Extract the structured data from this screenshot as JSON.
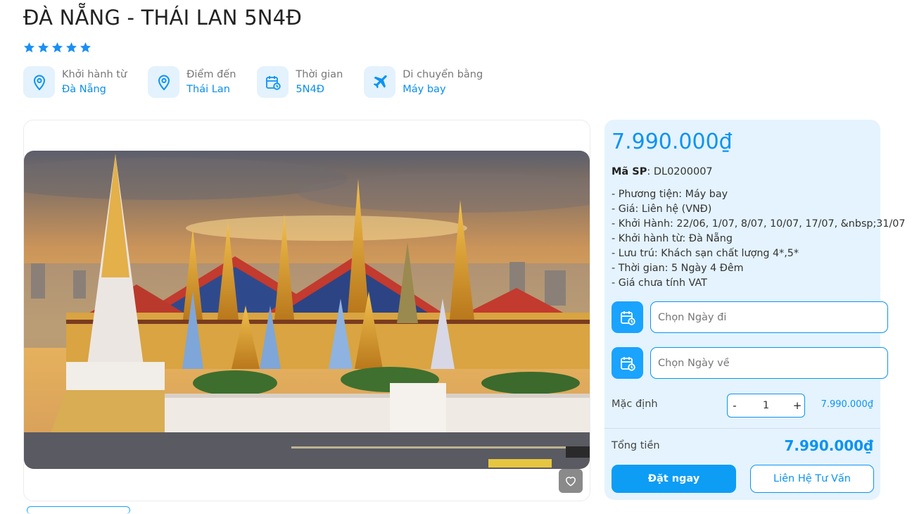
{
  "tour": {
    "title": "ĐÀ NẴNG - THÁI LAN 5N4Đ",
    "rating": 5,
    "info": [
      {
        "label": "Khởi hành từ",
        "value": "Đà Nẵng",
        "icon": "location-pin-icon"
      },
      {
        "label": "Điểm đến",
        "value": "Thái Lan",
        "icon": "location-pin-icon"
      },
      {
        "label": "Thời gian",
        "value": "5N4Đ",
        "icon": "calendar-clock-icon"
      },
      {
        "label": "Di chuyển bằng",
        "value": "Máy bay",
        "icon": "airplane-icon"
      }
    ]
  },
  "booking": {
    "price": "7.990.000₫",
    "sku_label": "Mã SP",
    "sku_value": ": DL0200007",
    "features": [
      "- Phương tiện: Máy bay",
      "- Giá: Liên hệ (VNĐ)",
      "- Khởi Hành: 22/06, 1/07, 8/07, 10/07, 17/07, &nbsp;31/07",
      "- Khởi hành từ: Đà Nẵng",
      "- Lưu trú: Khách sạn chất lượng 4*,5*",
      "- Thời gian: 5 Ngày 4 Đêm",
      "- Giá chưa tính VAT"
    ],
    "depart_placeholder": "Chọn Ngày đi",
    "return_placeholder": "Chọn Ngày về",
    "qty_label": "Mặc định",
    "qty_minus": "-",
    "qty_value": "1",
    "qty_plus": "+",
    "qty_price": "7.990.000₫",
    "total_label": "Tổng tiền",
    "total_value": "7.990.000₫",
    "book_label": "Đặt ngay",
    "consult_label": "Liên Hệ Tư Vấn"
  },
  "colors": {
    "accent": "#0d93f0",
    "panel": "#e4f3fe",
    "icon_bg": "#e3f2fd"
  }
}
